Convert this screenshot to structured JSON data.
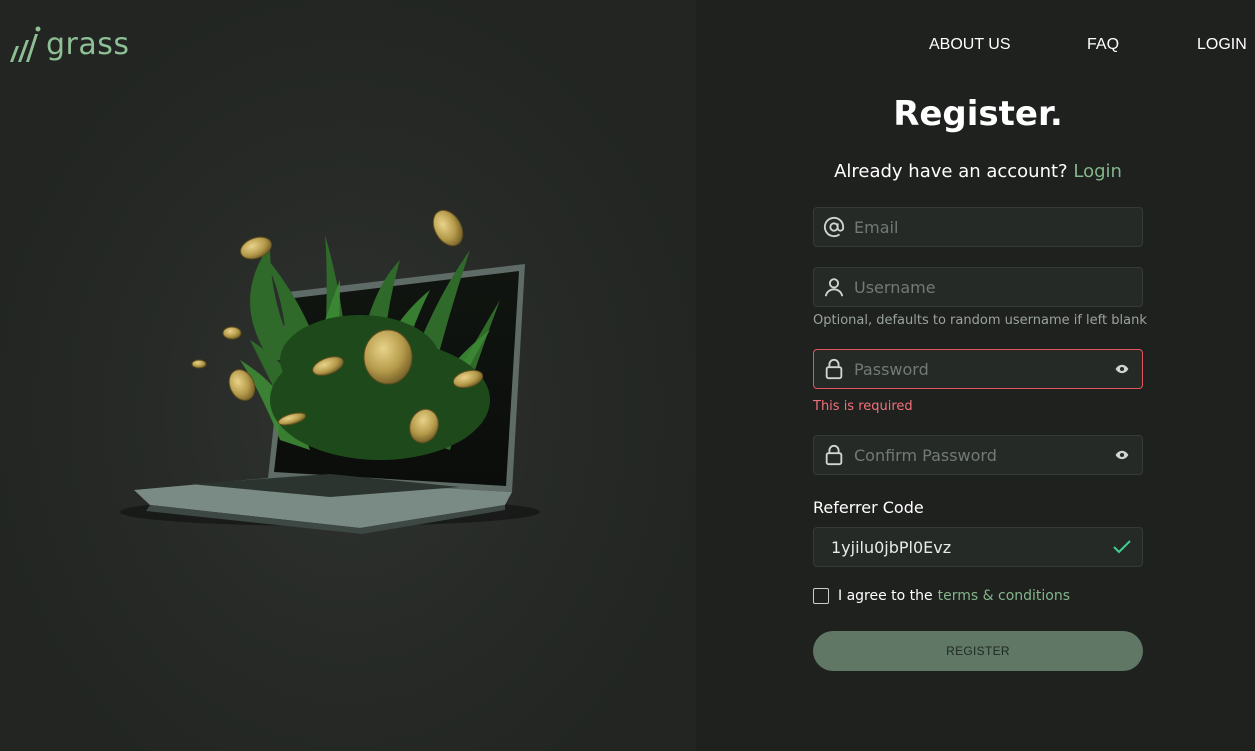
{
  "brand": {
    "name": "grass",
    "accent": "#84b58b"
  },
  "nav": {
    "about": "ABOUT US",
    "faq": "FAQ",
    "login": "LOGIN"
  },
  "form": {
    "title": "Register.",
    "already_text": "Already have an account?",
    "login_link": "Login",
    "email": {
      "placeholder": "Email",
      "icon": "at-icon"
    },
    "username": {
      "placeholder": "Username",
      "icon": "user-icon",
      "hint": "Optional, defaults to random username if left blank"
    },
    "password": {
      "placeholder": "Password",
      "icon": "lock-icon",
      "error": "This is required"
    },
    "confirm_password": {
      "placeholder": "Confirm Password",
      "icon": "lock-icon"
    },
    "referrer": {
      "label": "Referrer Code",
      "value": "1yjilu0jbPl0Evz",
      "status_icon": "check-icon"
    },
    "agree": {
      "text": "I agree to the",
      "link": "terms & conditions",
      "checked": false
    },
    "submit_label": "REGISTER"
  },
  "colors": {
    "error": "#e0555e",
    "success": "#3ecf8e"
  }
}
